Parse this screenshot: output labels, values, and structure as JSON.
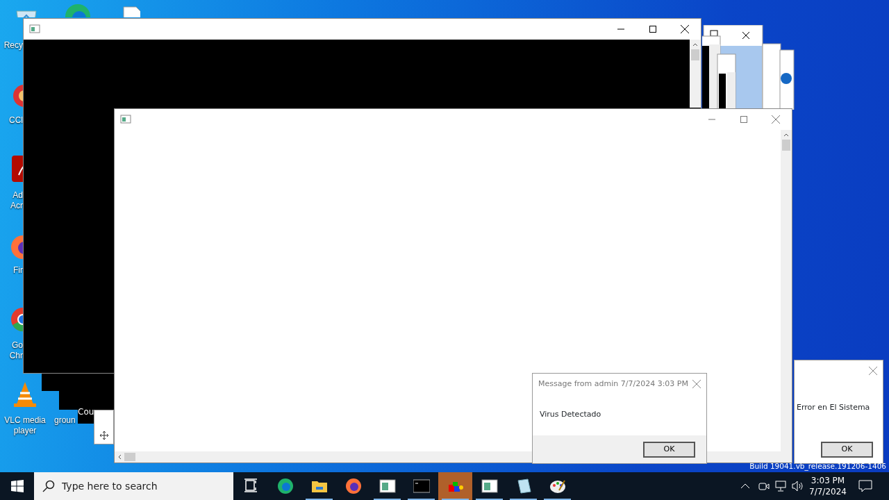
{
  "desktop_icons": [
    {
      "kind": "recycle-bin",
      "label": [
        "Recy"
      ]
    },
    {
      "kind": "edge"
    },
    {
      "kind": "document"
    },
    {
      "kind": "ccleaner",
      "label": [
        "CCl"
      ]
    },
    {
      "kind": "acrobat",
      "label": [
        "Ad",
        "Acr"
      ]
    },
    {
      "kind": "firefox",
      "label": [
        "Fir"
      ]
    },
    {
      "kind": "chrome",
      "label": [
        "Go",
        "Chr"
      ]
    },
    {
      "kind": "vlc",
      "label": [
        "VLC media",
        "player"
      ]
    },
    {
      "kind": "hidden",
      "label": [
        "groun"
      ]
    }
  ],
  "console_fragment": "Cou",
  "windows": [
    {
      "kind": "console"
    },
    {
      "kind": "blank"
    }
  ],
  "dialogs": [
    {
      "title": "Message from admin 7/7/2024 3:03 PM",
      "message": "Virus Detectado",
      "button": "OK"
    },
    {
      "message": "Error en El Sistema",
      "button": "OK"
    }
  ],
  "build_info": "Build 19041.vb_release.191206-1406",
  "taskbar": {
    "search_placeholder": "Type here to search",
    "apps": [
      {
        "kind": "task-view",
        "running": false,
        "selected": false
      },
      {
        "kind": "edge",
        "running": false,
        "selected": false
      },
      {
        "kind": "folder",
        "running": true,
        "selected": false
      },
      {
        "kind": "firefox",
        "running": false,
        "selected": false
      },
      {
        "kind": "window",
        "running": true,
        "selected": false
      },
      {
        "kind": "terminal",
        "running": true,
        "selected": false
      },
      {
        "kind": "cubes",
        "running": true,
        "selected": true
      },
      {
        "kind": "window",
        "running": true,
        "selected": false
      },
      {
        "kind": "notepad",
        "running": true,
        "selected": false
      },
      {
        "kind": "paint",
        "running": true,
        "selected": false
      }
    ],
    "tray": {
      "time": "3:03 PM",
      "date": "7/7/2024"
    }
  }
}
